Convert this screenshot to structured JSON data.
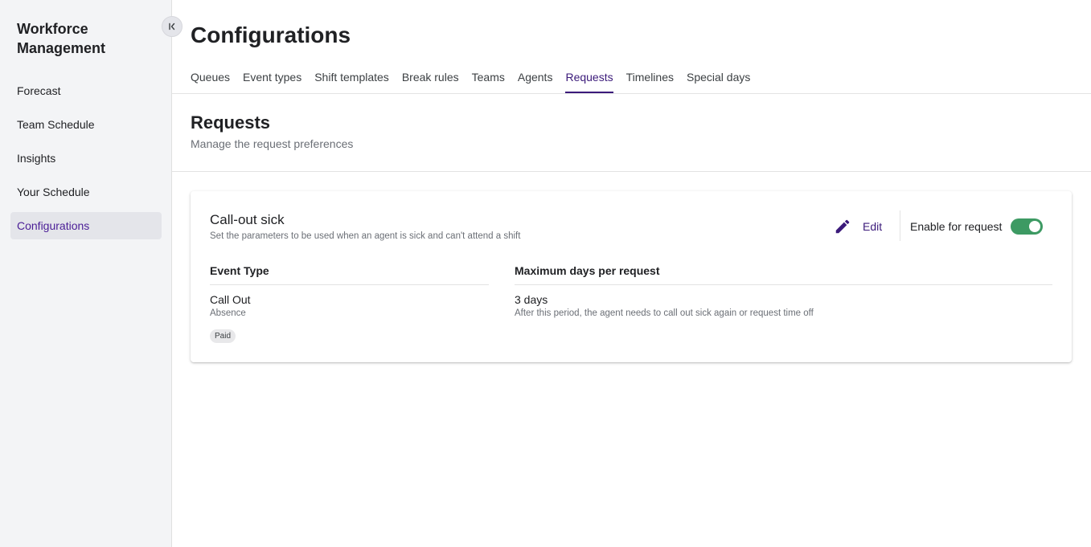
{
  "app": {
    "title": "Workforce Management"
  },
  "sidebar": {
    "items": [
      {
        "label": "Forecast"
      },
      {
        "label": "Team Schedule"
      },
      {
        "label": "Insights"
      },
      {
        "label": "Your Schedule"
      },
      {
        "label": "Configurations",
        "active": true
      }
    ]
  },
  "header": {
    "title": "Configurations",
    "tabs": [
      {
        "label": "Queues"
      },
      {
        "label": "Event types"
      },
      {
        "label": "Shift templates"
      },
      {
        "label": "Break rules"
      },
      {
        "label": "Teams"
      },
      {
        "label": "Agents"
      },
      {
        "label": "Requests",
        "active": true
      },
      {
        "label": "Timelines"
      },
      {
        "label": "Special days"
      }
    ]
  },
  "section": {
    "title": "Requests",
    "subtitle": "Manage the request preferences"
  },
  "card": {
    "title": "Call-out sick",
    "subtitle": "Set the parameters to be used when an agent is sick and can't attend a shift",
    "edit_label": "Edit",
    "enable_label": "Enable for request",
    "enabled": true,
    "columns": {
      "event_type": {
        "header": "Event Type",
        "value": "Call Out",
        "category": "Absence",
        "badge": "Paid"
      },
      "max_days": {
        "header": "Maximum days per request",
        "value": "3 days",
        "note": "After this period, the agent needs to call out sick again or request time off"
      }
    }
  },
  "colors": {
    "accent": "#3b1a7a",
    "toggle_on": "#3d9a63",
    "sidebar_bg": "#f3f4f6"
  },
  "icons": {
    "collapse": "collapse-left-icon",
    "edit": "pencil-icon"
  }
}
